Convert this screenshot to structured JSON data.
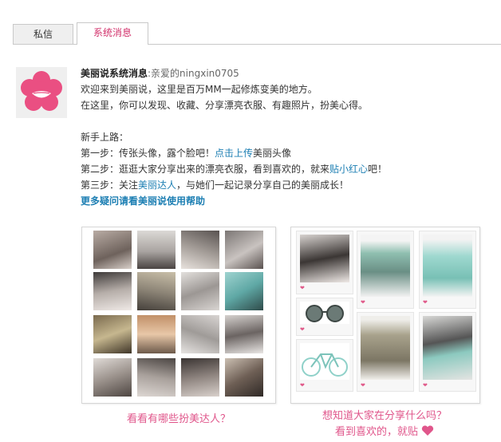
{
  "tabs": [
    {
      "label": "私信"
    },
    {
      "label": "系统消息"
    }
  ],
  "message": {
    "title": "美丽说系统消息",
    "sender": ":亲爱的ningxin0705",
    "line1": "欢迎来到美丽说，这里是百万MM一起修炼变美的地方。",
    "line2": "在这里，你可以发现、收藏、分享漂亮衣服、有趣照片，扮美心得。",
    "guide_title": "新手上路：",
    "step1_prefix": "第一步：传张头像，露个脸吧！",
    "step1_link": "点击上传",
    "step1_suffix": "美丽头像",
    "step2_prefix": "第二步：逛逛大家分享出来的漂亮衣服，看到喜欢的，就来",
    "step2_link": "贴小红心",
    "step2_suffix": "吧！",
    "step3_prefix": "第三步：关注",
    "step3_link": "美丽达人",
    "step3_suffix": "，与她们一起记录分享自己的美丽成长！",
    "help_link": "更多疑问请看美丽说使用帮助"
  },
  "captions": {
    "left": "看看有哪些扮美达人？",
    "right_line1": "想知道大家在分享什么吗？",
    "right_line2": "看到喜欢的，就贴"
  },
  "colors": {
    "accent_pink": "#e0568b",
    "link_blue": "#1d7fb3",
    "tab_active_text": "#d2316b"
  }
}
